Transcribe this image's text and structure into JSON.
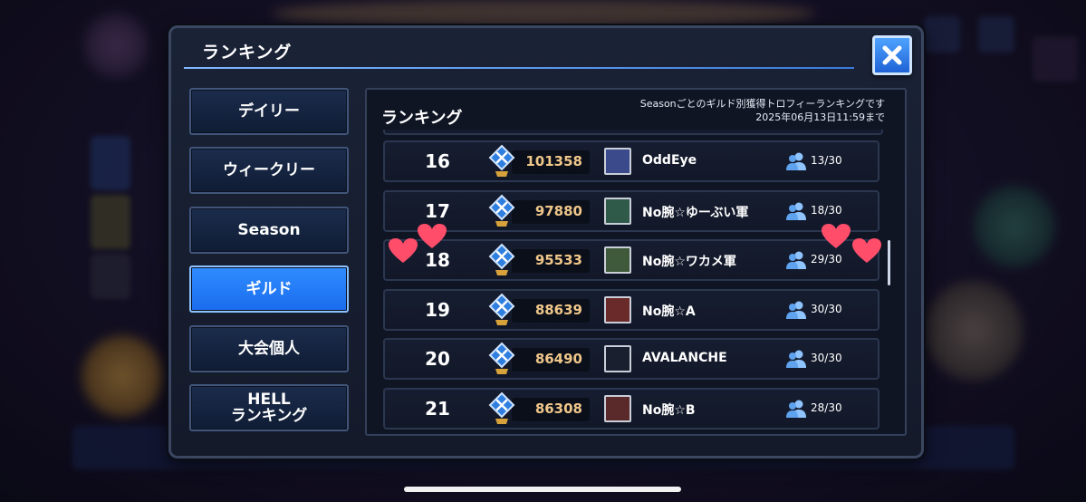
{
  "dialog": {
    "title": "ランキング",
    "close_icon": "close-icon"
  },
  "tabs": [
    {
      "label": "デイリー",
      "active": false
    },
    {
      "label": "ウィークリー",
      "active": false
    },
    {
      "label": "Season",
      "active": false
    },
    {
      "label": "ギルド",
      "active": true
    },
    {
      "label": "大会個人",
      "active": false
    },
    {
      "label": "HELL\nランキング",
      "active": false
    }
  ],
  "panel": {
    "title": "ランキング",
    "note_line1": "Seasonごとのギルド別獲得トロフィーランキングです",
    "note_line2": "2025年06月13日11:59まで"
  },
  "rows": [
    {
      "rank": "16",
      "score": "101358",
      "guild": "OddEye",
      "members": "13/30",
      "emblem_color": "#3a4a8a"
    },
    {
      "rank": "17",
      "score": "97880",
      "guild": "No腕☆ゆーぶい軍",
      "members": "18/30",
      "emblem_color": "#2f5a4a"
    },
    {
      "rank": "18",
      "score": "95533",
      "guild": "No腕☆ワカメ軍",
      "members": "29/30",
      "emblem_color": "#3e5a3a"
    },
    {
      "rank": "19",
      "score": "88639",
      "guild": "No腕☆A",
      "members": "30/30",
      "emblem_color": "#6a2a2a"
    },
    {
      "rank": "20",
      "score": "86490",
      "guild": "AVALANCHE",
      "members": "30/30",
      "emblem_color": "#1a1f30"
    },
    {
      "rank": "21",
      "score": "86308",
      "guild": "No腕☆B",
      "members": "28/30",
      "emblem_color": "#5a2a2a"
    }
  ],
  "colors": {
    "accent": "#2f8cff",
    "score": "#f0c78a",
    "heart": "#ff4d6a"
  },
  "icons": {
    "trophy": "trophy-icon",
    "members": "members-icon",
    "heart": "heart-icon"
  }
}
